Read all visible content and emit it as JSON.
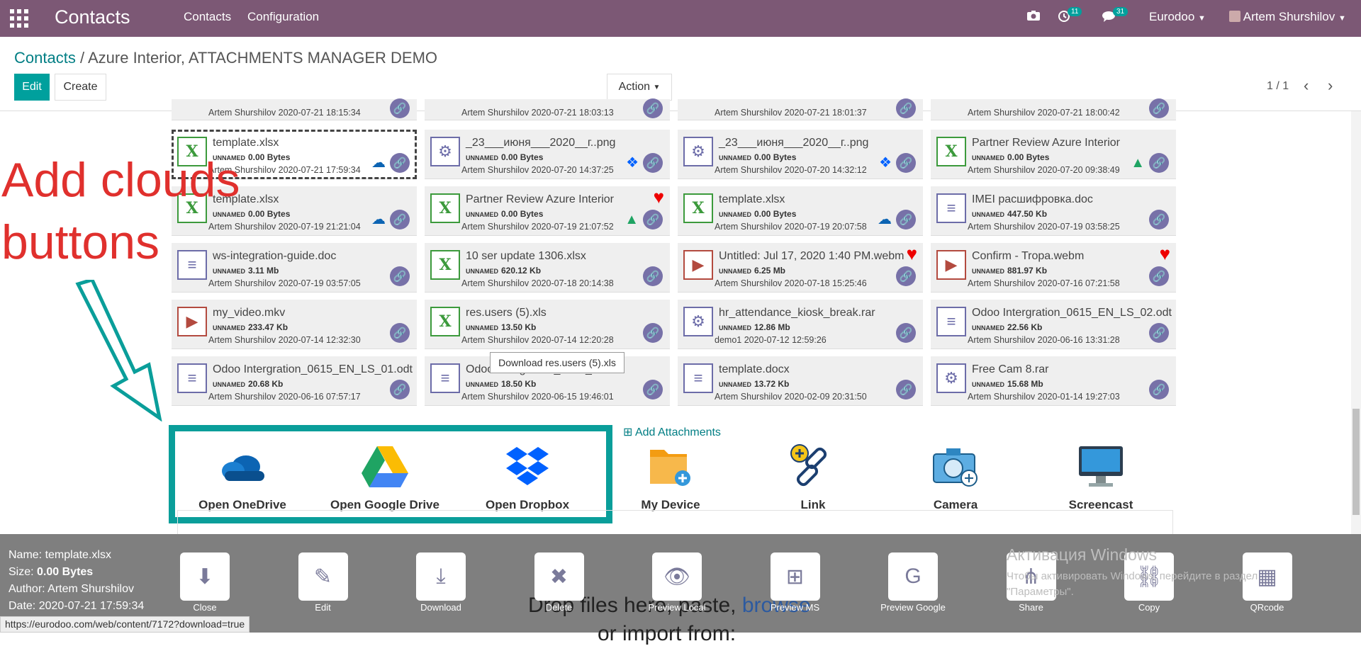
{
  "topbar": {
    "app_title": "Contacts",
    "menu": [
      "Contacts",
      "Configuration"
    ],
    "activity_count": "11",
    "message_count": "31",
    "company": "Eurodoo",
    "user": "Artem Shurshilov"
  },
  "breadcrumb": {
    "parent": "Contacts",
    "sep": "/",
    "current": "Azure Interior, ATTACHMENTS MANAGER DEMO"
  },
  "buttons": {
    "edit": "Edit",
    "create": "Create",
    "action": "Action"
  },
  "pager": "1 / 1",
  "tiles_top": [
    "Artem Shurshilov 2020-07-21 18:15:34",
    "Artem Shurshilov 2020-07-21 18:03:13",
    "Artem Shurshilov 2020-07-21 18:01:37",
    "Artem Shurshilov 2020-07-21 18:00:42"
  ],
  "tiles": [
    {
      "name": "template.xlsx",
      "size_label": "UNNAMED",
      "size": "0.00 Bytes",
      "author": "Artem Shurshilov 2020-07-21 17:59:34",
      "icon": "excel-icon",
      "cloud": "onedrive"
    },
    {
      "name": "_23___июня___2020__г..png",
      "size_label": "UNNAMED",
      "size": "0.00 Bytes",
      "author": "Artem Shurshilov 2020-07-20 14:37:25",
      "icon": "gear-icon",
      "cloud": "dropbox"
    },
    {
      "name": "_23___июня___2020__г..png",
      "size_label": "UNNAMED",
      "size": "0.00 Bytes",
      "author": "Artem Shurshilov 2020-07-20 14:32:12",
      "icon": "gear-icon",
      "cloud": "dropbox"
    },
    {
      "name": "Partner Review Azure Interior",
      "size_label": "UNNAMED",
      "size": "0.00 Bytes",
      "author": "Artem Shurshilov 2020-07-20 09:38:49",
      "icon": "excel-icon",
      "cloud": "gdrive"
    },
    {
      "name": "template.xlsx",
      "size_label": "UNNAMED",
      "size": "0.00 Bytes",
      "author": "Artem Shurshilov 2020-07-19 21:21:04",
      "icon": "excel-icon",
      "cloud": "onedrive"
    },
    {
      "name": "Partner Review Azure Interior",
      "size_label": "UNNAMED",
      "size": "0.00 Bytes",
      "author": "Artem Shurshilov 2020-07-19 21:07:52",
      "icon": "excel-icon",
      "cloud": "gdrive",
      "heart": true
    },
    {
      "name": "template.xlsx",
      "size_label": "UNNAMED",
      "size": "0.00 Bytes",
      "author": "Artem Shurshilov 2020-07-19 20:07:58",
      "icon": "excel-icon",
      "cloud": "onedrive"
    },
    {
      "name": "IMEI расшифровка.doc",
      "size_label": "UNNAMED",
      "size": "447.50 Kb",
      "author": "Artem Shurshilov 2020-07-19 03:58:25",
      "icon": "doc-icon"
    },
    {
      "name": "ws-integration-guide.doc",
      "size_label": "UNNAMED",
      "size": "3.11 Mb",
      "author": "Artem Shurshilov 2020-07-19 03:57:05",
      "icon": "doc-icon"
    },
    {
      "name": "10 ser update 1306.xlsx",
      "size_label": "UNNAMED",
      "size": "620.12 Kb",
      "author": "Artem Shurshilov 2020-07-18 20:14:38",
      "icon": "excel-icon"
    },
    {
      "name": "Untitled: Jul 17, 2020 1:40 PM.webm",
      "size_label": "UNNAMED",
      "size": "6.25 Mb",
      "author": "Artem Shurshilov 2020-07-18 15:25:46",
      "icon": "video-icon",
      "heart": true
    },
    {
      "name": "Confirm - Tropa.webm",
      "size_label": "UNNAMED",
      "size": "881.97 Kb",
      "author": "Artem Shurshilov 2020-07-16 07:21:58",
      "icon": "video-icon",
      "heart": true
    },
    {
      "name": "my_video.mkv",
      "size_label": "UNNAMED",
      "size": "233.47 Kb",
      "author": "Artem Shurshilov 2020-07-14 12:32:30",
      "icon": "video-icon"
    },
    {
      "name": "res.users (5).xls",
      "size_label": "UNNAMED",
      "size": "13.50 Kb",
      "author": "Artem Shurshilov 2020-07-14 12:20:28",
      "icon": "excel-icon"
    },
    {
      "name": "hr_attendance_kiosk_break.rar",
      "size_label": "UNNAMED",
      "size": "12.86 Mb",
      "author": "demo1 2020-07-12 12:59:26",
      "icon": "gear-icon"
    },
    {
      "name": "Odoo Intergration_0615_EN_LS_02.odt",
      "size_label": "UNNAMED",
      "size": "22.56 Kb",
      "author": "Artem Shurshilov 2020-06-16 13:31:28",
      "icon": "doc-icon"
    },
    {
      "name": "Odoo Intergration_0615_EN_LS_01.odt",
      "size_label": "UNNAMED",
      "size": "20.68 Kb",
      "author": "Artem Shurshilov 2020-06-16 07:57:17",
      "icon": "doc-icon"
    },
    {
      "name": "Odoo Intergration_0615_R.odt",
      "size_label": "UNNAMED",
      "size": "18.50 Kb",
      "author": "Artem Shurshilov 2020-06-15 19:46:01",
      "icon": "doc-icon"
    },
    {
      "name": "template.docx",
      "size_label": "UNNAMED",
      "size": "13.72 Kb",
      "author": "Artem Shurshilov 2020-02-09 20:31:50",
      "icon": "doc-icon"
    },
    {
      "name": "Free Cam 8.rar",
      "size_label": "UNNAMED",
      "size": "15.68 Mb",
      "author": "Artem Shurshilov 2020-01-14 19:27:03",
      "icon": "gear-icon"
    }
  ],
  "tooltip": "Download res.users (5).xls",
  "annotation": "Add clouds buttons",
  "add_attachments": "Add Attachments",
  "upload_buttons": [
    "Open OneDrive",
    "Open Google Drive",
    "Open Dropbox",
    "My Device",
    "Link",
    "Camera",
    "Screencast"
  ],
  "info": {
    "name_label": "Name:",
    "name": "template.xlsx",
    "size_label": "Size:",
    "size": "0.00 Bytes",
    "author_label": "Author:",
    "author": "Artem Shurshilov",
    "date_label": "Date:",
    "date": "2020-07-21 17:59:34"
  },
  "panel_buttons": [
    "Close",
    "Edit",
    "Download",
    "Delete",
    "Preview Local",
    "Preview MS",
    "Preview Google",
    "Share",
    "Copy",
    "QRcode"
  ],
  "drop_text": "Drop files here, paste, ",
  "drop_link": "browse",
  "drop_text2": "or import from:",
  "windows": {
    "title": "Активация Windows",
    "body": "Чтобы активировать Windows, перейдите в раздел \"Параметры\"."
  },
  "status_url": "https://eurodoo.com/web/content/7172?download=true",
  "colors": {
    "topbar": "#7c5875",
    "accent": "#00a09d",
    "annotation": "#e0302d",
    "frame": "#0a9e9a"
  }
}
